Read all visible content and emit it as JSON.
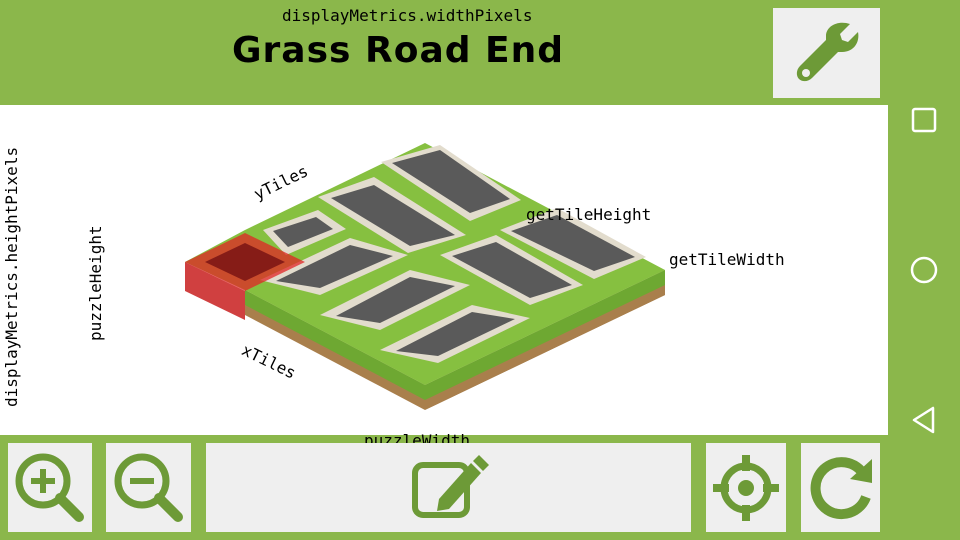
{
  "header": {
    "width_label": "displayMetrics.widthPixels",
    "title": "Grass Road End"
  },
  "toolbar": {
    "settings_icon": "wrench-icon",
    "zoom_in_icon": "zoom-in-icon",
    "zoom_out_icon": "zoom-out-icon",
    "edit_icon": "edit-icon",
    "center_icon": "crosshair-icon",
    "rotate_icon": "rotate-icon"
  },
  "canvas": {
    "height_label": "displayMetrics.heightPixels",
    "puzzle_height_label": "puzzleHeight",
    "puzzle_width_label": "puzzleWidth",
    "ytiles_label": "yTiles",
    "xtiles_label": "xTiles",
    "tile_height_label": "getTileHeight",
    "tile_width_label": "getTileWidth"
  },
  "nav": {
    "recents_icon": "square-icon",
    "home_icon": "circle-icon",
    "back_icon": "triangle-back-icon"
  },
  "colors": {
    "accent_green": "#8bb74b",
    "icon_green": "#6d9a37",
    "grass": "#86c040",
    "road": "#5a5a5a",
    "curb": "#e2dccd",
    "dirt": "#a97f4c",
    "selection": "#e02525"
  }
}
